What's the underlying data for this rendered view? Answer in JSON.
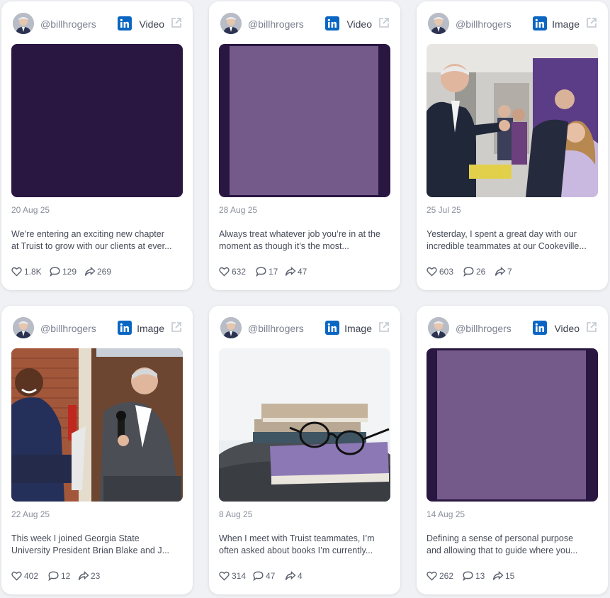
{
  "cards": [
    {
      "handle": "@billhrogers",
      "network": "linkedin-icon",
      "media_type": "Video",
      "date": "20 Aug 25",
      "text_line1": "We’re entering an exciting new chapter",
      "text_line2": "at Truist to grow with our clients at ever...",
      "likes": "1.8K",
      "comments": "129",
      "shares": "269"
    },
    {
      "handle": "@billhrogers",
      "network": "linkedin-icon",
      "media_type": "Video",
      "date": "28 Aug 25",
      "text_line1": "Always treat whatever job you’re in at the",
      "text_line2": "moment as though it’s the most...",
      "likes": "632",
      "comments": "17",
      "shares": "47"
    },
    {
      "handle": "@billhrogers",
      "network": "linkedin-icon",
      "media_type": "Image",
      "date": "25 Jul 25",
      "text_line1": "Yesterday, I spent a great day with our",
      "text_line2": "incredible teammates at our Cookeville...",
      "likes": "603",
      "comments": "26",
      "shares": "7"
    },
    {
      "handle": "@billhrogers",
      "network": "linkedin-icon",
      "media_type": "Image",
      "date": "22 Aug 25",
      "text_line1": "This week I joined Georgia State",
      "text_line2": "University President Brian Blake and J...",
      "likes": "402",
      "comments": "12",
      "shares": "23"
    },
    {
      "handle": "@billhrogers",
      "network": "linkedin-icon",
      "media_type": "Image",
      "date": "8 Aug 25",
      "text_line1": "When I meet with Truist teammates, I’m",
      "text_line2": "often asked about books I’m currently...",
      "likes": "314",
      "comments": "47",
      "shares": "4"
    },
    {
      "handle": "@billhrogers",
      "network": "linkedin-icon",
      "media_type": "Video",
      "date": "14 Aug 25",
      "text_line1": "Defining a sense of personal purpose",
      "text_line2": "and allowing that to guide where you...",
      "likes": "262",
      "comments": "13",
      "shares": "15"
    }
  ],
  "colors": {
    "linkedin": "#0a66c2",
    "video_dark": "#2a1741",
    "video_light": "#745a8a",
    "page_bg": "#f0f1f4"
  }
}
